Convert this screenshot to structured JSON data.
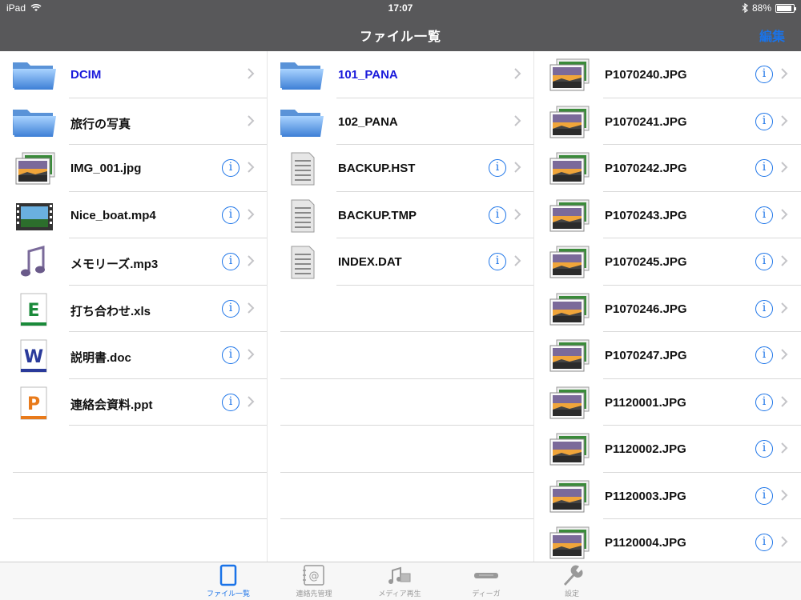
{
  "status_bar": {
    "device": "iPad",
    "time": "17:07",
    "battery": "88%",
    "battery_level": 0.88
  },
  "nav": {
    "title": "ファイル一覧",
    "edit": "編集"
  },
  "columns": [
    [
      {
        "label": "DCIM",
        "icon": "folder-icon",
        "highlight": true,
        "info": false
      },
      {
        "label": "旅行の写真",
        "icon": "folder-icon",
        "highlight": false,
        "info": false
      },
      {
        "label": "IMG_001.jpg",
        "icon": "photo-icon",
        "highlight": false,
        "info": true
      },
      {
        "label": "Nice_boat.mp4",
        "icon": "video-icon",
        "highlight": false,
        "info": true
      },
      {
        "label": "メモリーズ.mp3",
        "icon": "music-icon",
        "highlight": false,
        "info": true
      },
      {
        "label": "打ち合わせ.xls",
        "icon": "excel-icon",
        "highlight": false,
        "info": true
      },
      {
        "label": "説明書.doc",
        "icon": "word-icon",
        "highlight": false,
        "info": true
      },
      {
        "label": "連絡会資料.ppt",
        "icon": "powerpoint-icon",
        "highlight": false,
        "info": true
      },
      null,
      null,
      null
    ],
    [
      {
        "label": "101_PANA",
        "icon": "folder-icon",
        "highlight": true,
        "info": false
      },
      {
        "label": "102_PANA",
        "icon": "folder-icon",
        "highlight": false,
        "info": false
      },
      {
        "label": "BACKUP.HST",
        "icon": "document-icon",
        "highlight": false,
        "info": true
      },
      {
        "label": "BACKUP.TMP",
        "icon": "document-icon",
        "highlight": false,
        "info": true
      },
      {
        "label": "INDEX.DAT",
        "icon": "document-icon",
        "highlight": false,
        "info": true
      },
      null,
      null,
      null,
      null,
      null,
      null
    ],
    [
      {
        "label": "P1070240.JPG",
        "icon": "photo-icon",
        "highlight": false,
        "info": true
      },
      {
        "label": "P1070241.JPG",
        "icon": "photo-icon",
        "highlight": false,
        "info": true
      },
      {
        "label": "P1070242.JPG",
        "icon": "photo-icon",
        "highlight": false,
        "info": true
      },
      {
        "label": "P1070243.JPG",
        "icon": "photo-icon",
        "highlight": false,
        "info": true
      },
      {
        "label": "P1070245.JPG",
        "icon": "photo-icon",
        "highlight": false,
        "info": true
      },
      {
        "label": "P1070246.JPG",
        "icon": "photo-icon",
        "highlight": false,
        "info": true
      },
      {
        "label": "P1070247.JPG",
        "icon": "photo-icon",
        "highlight": false,
        "info": true
      },
      {
        "label": "P1120001.JPG",
        "icon": "photo-icon",
        "highlight": false,
        "info": true
      },
      {
        "label": "P1120002.JPG",
        "icon": "photo-icon",
        "highlight": false,
        "info": true
      },
      {
        "label": "P1120003.JPG",
        "icon": "photo-icon",
        "highlight": false,
        "info": true
      },
      {
        "label": "P1120004.JPG",
        "icon": "photo-icon",
        "highlight": false,
        "info": true
      }
    ]
  ],
  "tabs": [
    {
      "label": "ファイル一覧",
      "icon": "file-list-icon",
      "active": true
    },
    {
      "label": "連絡先管理",
      "icon": "contacts-icon",
      "active": false
    },
    {
      "label": "メディア再生",
      "icon": "media-player-icon",
      "active": false
    },
    {
      "label": "ディーガ",
      "icon": "recorder-icon",
      "active": false
    },
    {
      "label": "設定",
      "icon": "wrench-icon",
      "active": false
    }
  ],
  "colors": {
    "header": "#58585a",
    "accent": "#1a73e8",
    "highlight_text": "#1a1adb"
  }
}
